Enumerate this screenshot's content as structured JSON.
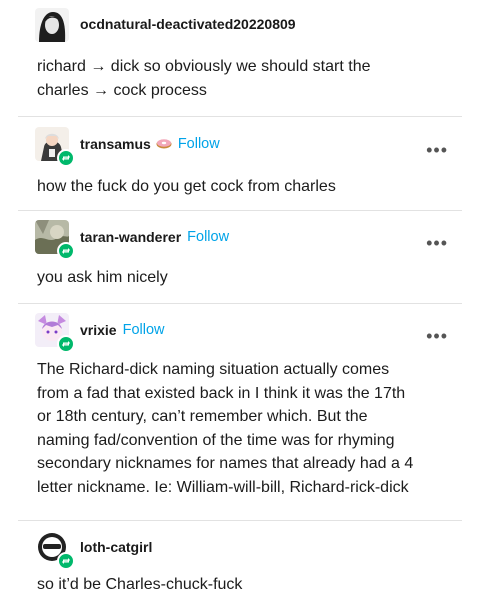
{
  "posts": [
    {
      "username": "ocdnatural-deactivated20220809",
      "lines": [
        "richard → dick so obviously we should start the",
        "charles → cock process"
      ]
    },
    {
      "username": "transamus",
      "follow": "Follow",
      "lines": [
        "how the fuck do you get cock from charles"
      ]
    },
    {
      "username": "taran-wanderer",
      "follow": "Follow",
      "lines": [
        "you ask him nicely"
      ]
    },
    {
      "username": "vrixie",
      "follow": "Follow",
      "lines": [
        "The Richard-dick naming situation actually comes",
        "from a fad that existed back in I think it was the 17th",
        "or 18th century, can’t remember which. But the",
        "naming fad/convention of the time was for rhyming",
        "secondary nicknames for names that already had a 4",
        "letter nickname. Ie: William-will-bill, Richard-rick-dick"
      ]
    },
    {
      "username": "loth-catgirl",
      "lines": [
        "so it’d be Charles-chuck-fuck"
      ]
    }
  ],
  "more_options": "•••",
  "colors": {
    "follow": "#00a3e8",
    "reblog_badge": "#00b86b",
    "divider": "#e2e2e2"
  },
  "icons": {
    "reblog_badge": "reblog-icon",
    "menu": "more-options-icon",
    "emoji": "donut-icon"
  }
}
